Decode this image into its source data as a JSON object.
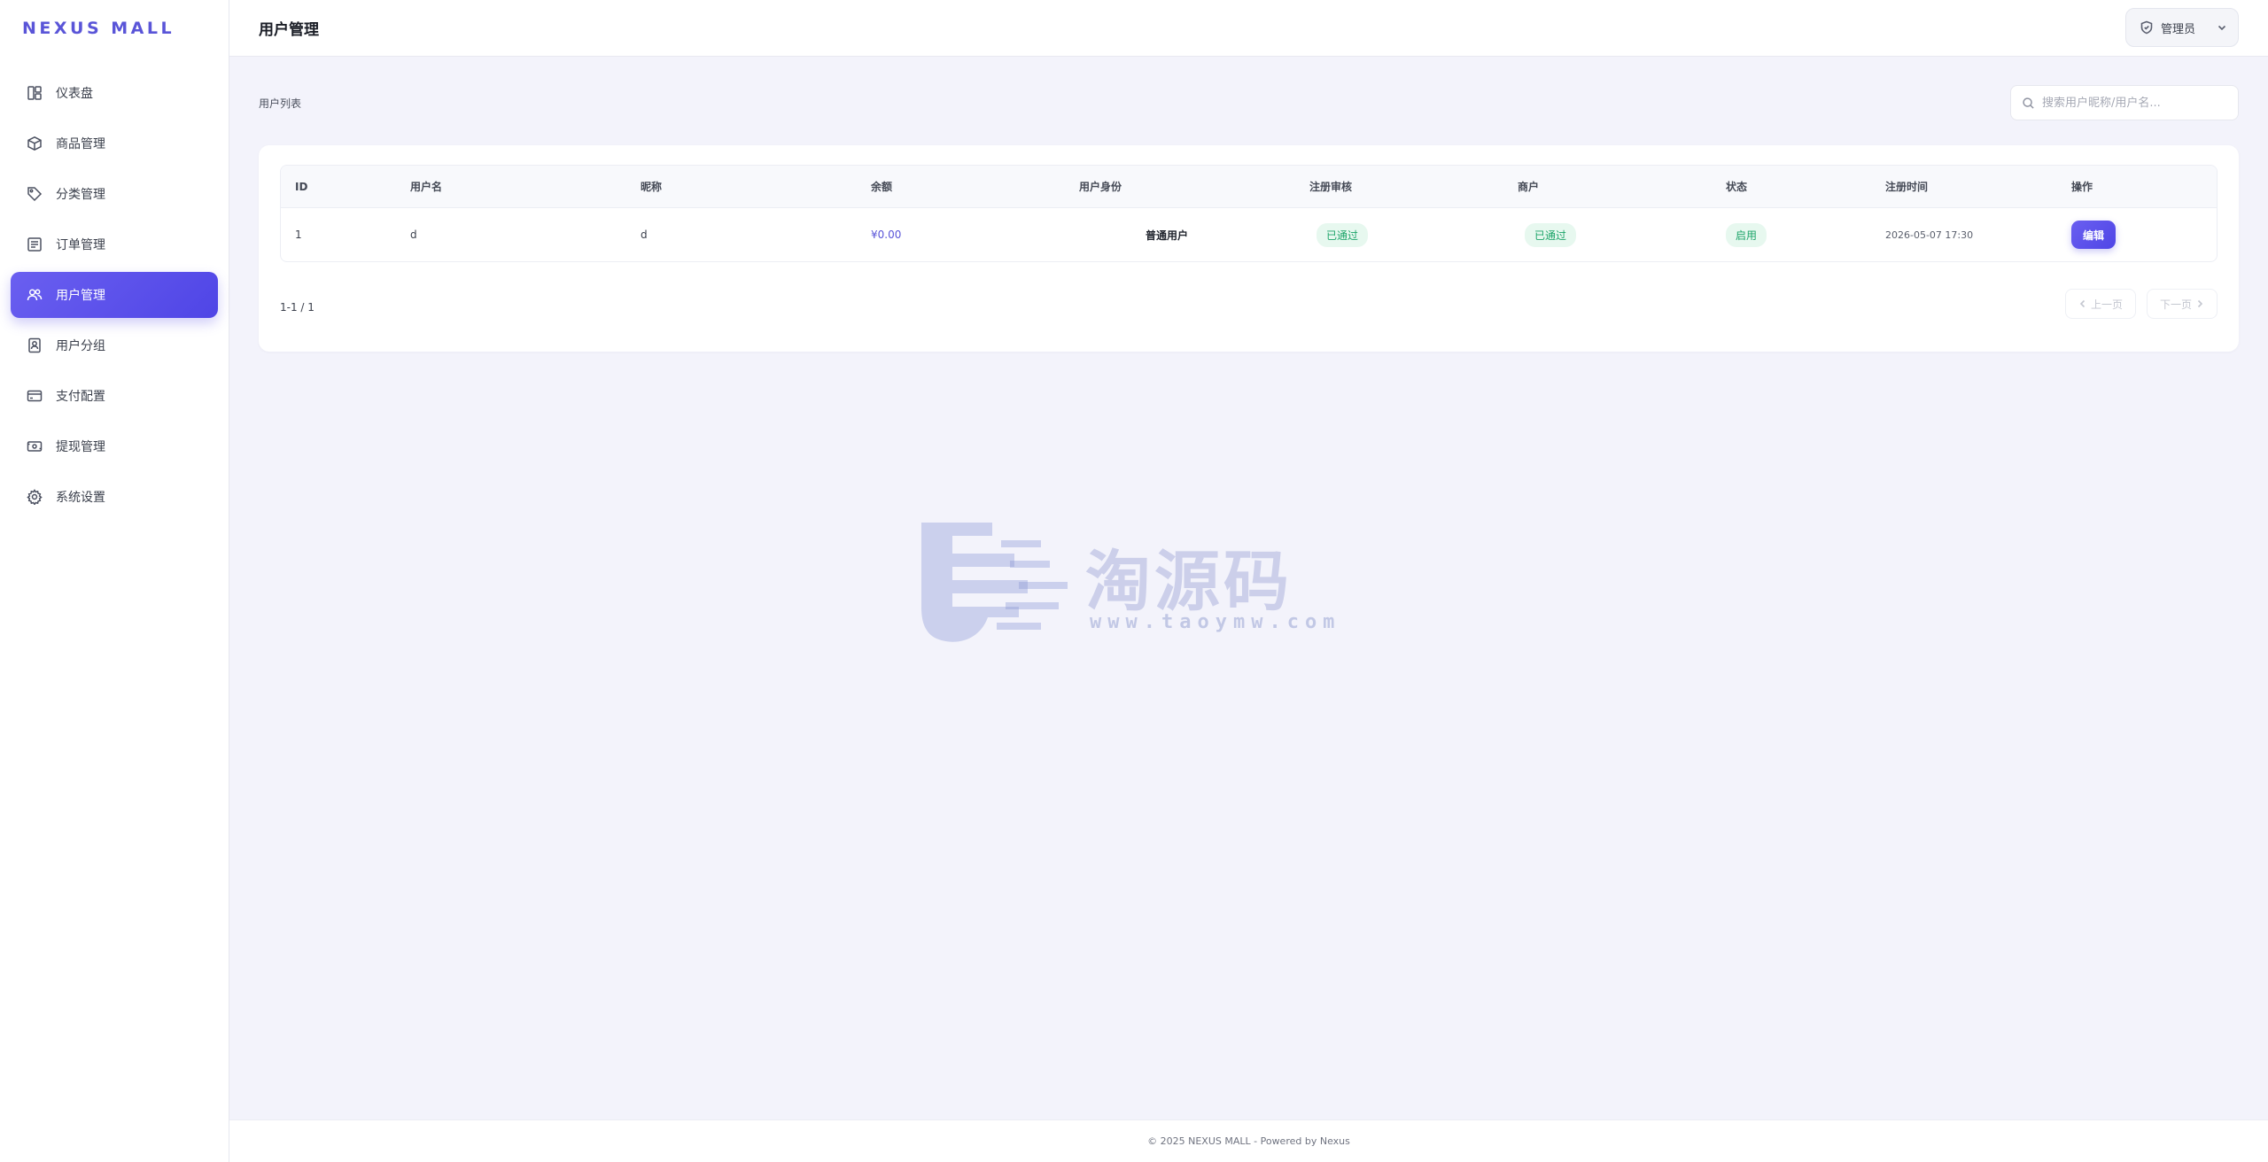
{
  "app": {
    "brand": "NEXUS MALL"
  },
  "sidebar": {
    "items": [
      {
        "label": "仪表盘",
        "icon": "dashboard-icon",
        "active": false
      },
      {
        "label": "商品管理",
        "icon": "box-icon",
        "active": false
      },
      {
        "label": "分类管理",
        "icon": "tag-icon",
        "active": false
      },
      {
        "label": "订单管理",
        "icon": "order-icon",
        "active": false
      },
      {
        "label": "用户管理",
        "icon": "users-icon",
        "active": true
      },
      {
        "label": "用户分组",
        "icon": "user-group-icon",
        "active": false
      },
      {
        "label": "支付配置",
        "icon": "credit-card-icon",
        "active": false
      },
      {
        "label": "提现管理",
        "icon": "withdraw-icon",
        "active": false
      },
      {
        "label": "系统设置",
        "icon": "gear-icon",
        "active": false
      }
    ]
  },
  "header": {
    "title": "用户管理",
    "admin_label": "管理员"
  },
  "main": {
    "section_label": "用户列表",
    "search_placeholder": "搜索用户昵称/用户名...",
    "table": {
      "columns": [
        "ID",
        "用户名",
        "昵称",
        "余额",
        "用户身份",
        "注册审核",
        "商户",
        "状态",
        "注册时间",
        "操作"
      ],
      "rows": [
        {
          "id": "1",
          "username": "d",
          "nickname": "d",
          "balance": "¥0.00",
          "identity": "普通用户",
          "registration_review": "已通过",
          "merchant": "已通过",
          "status": "启用",
          "registered_at": "2026-05-07 17:30",
          "action": "编辑"
        }
      ]
    },
    "pagination": {
      "info": "1-1 / 1",
      "prev_label": "上一页",
      "next_label": "下一页"
    }
  },
  "watermark": {
    "text": "淘源码",
    "url": "www.taoymw.com"
  },
  "footer": {
    "text": "© 2025 NEXUS MALL - Powered by Nexus"
  },
  "colors": {
    "accent": "#5a50e8",
    "success_bg": "#e7f8ef",
    "success_text": "#1ea56a",
    "page_bg": "#f3f3fb"
  }
}
